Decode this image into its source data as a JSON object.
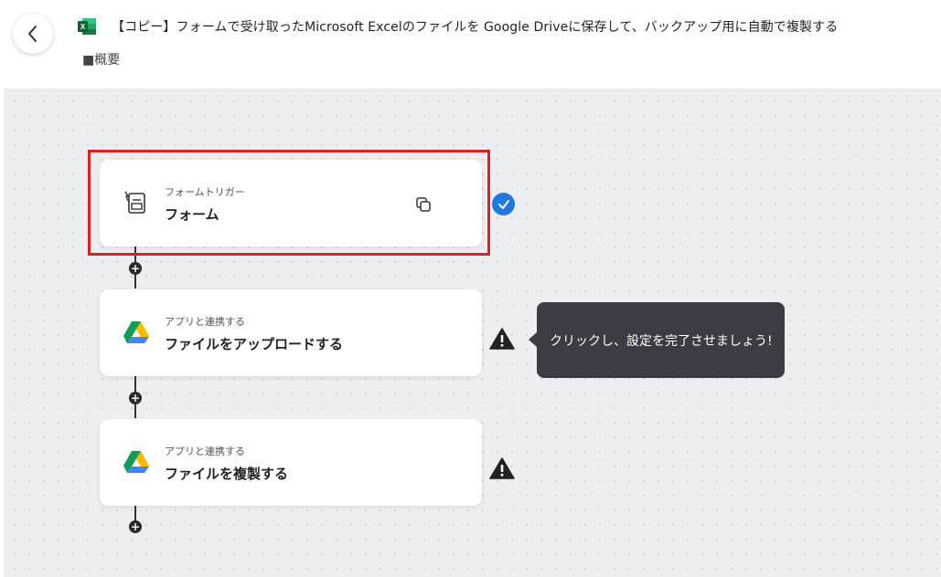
{
  "header": {
    "title": "【コピー】フォームで受け取ったMicrosoft Excelのファイルを Google Driveに保存して、バックアップ用に自動で複製する",
    "overview": "■概要"
  },
  "flow": {
    "steps": [
      {
        "subtitle": "フォームトリガー",
        "title": "フォーム",
        "status": "complete"
      },
      {
        "subtitle": "アプリと連携する",
        "title": "ファイルをアップロードする",
        "status": "warning"
      },
      {
        "subtitle": "アプリと連携する",
        "title": "ファイルを複製する",
        "status": "warning"
      }
    ],
    "tooltip": "クリックし、設定を完了させましょう!"
  },
  "colors": {
    "highlight": "#e21f1f",
    "check": "#1f7ae0",
    "tooltip_bg": "#3a3d41",
    "canvas_bg": "#eceef1"
  }
}
